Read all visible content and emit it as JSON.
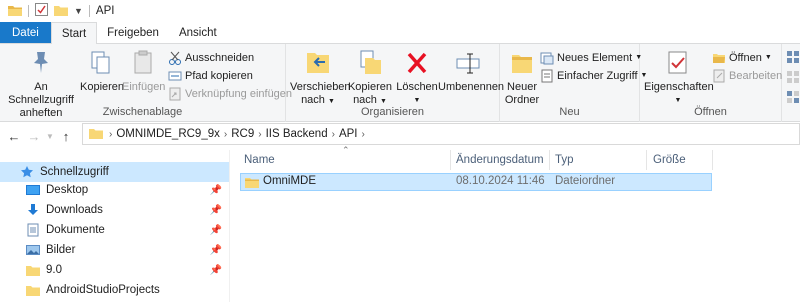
{
  "window": {
    "title": "API"
  },
  "tabs": [
    {
      "label": "Datei"
    },
    {
      "label": "Start"
    },
    {
      "label": "Freigeben"
    },
    {
      "label": "Ansicht"
    }
  ],
  "ribbon": {
    "clipboard": {
      "label": "Zwischenablage",
      "pin": {
        "line1": "An Schnellzugriff",
        "line2": "anheften"
      },
      "copy": "Kopieren",
      "paste": "Einfügen",
      "cut": "Ausschneiden",
      "copy_path": "Pfad kopieren",
      "paste_shortcut": "Verknüpfung einfügen"
    },
    "organize": {
      "label": "Organisieren",
      "move": {
        "line1": "Verschieben",
        "line2": "nach"
      },
      "copyto": {
        "line1": "Kopieren",
        "line2": "nach"
      },
      "delete": "Löschen",
      "rename": "Umbenennen"
    },
    "new": {
      "label": "Neu",
      "new_folder": {
        "line1": "Neuer",
        "line2": "Ordner"
      },
      "new_item": "Neues Element",
      "easy_access": "Einfacher Zugriff"
    },
    "open": {
      "label": "Öffnen",
      "properties": "Eigenschaften",
      "open": "Öffnen",
      "edit": "Bearbeiten"
    }
  },
  "address": {
    "crumbs": [
      "OMNIMDE_RC9_9x",
      "RC9",
      "IIS Backend",
      "API"
    ]
  },
  "nav": {
    "quick_access": "Schnellzugriff",
    "items": [
      {
        "label": "Desktop",
        "icon": "desktop-icon"
      },
      {
        "label": "Downloads",
        "icon": "download-icon"
      },
      {
        "label": "Dokumente",
        "icon": "documents-icon"
      },
      {
        "label": "Bilder",
        "icon": "pictures-icon"
      },
      {
        "label": "9.0",
        "icon": "folder-icon"
      },
      {
        "label": "AndroidStudioProjects",
        "icon": "folder-icon"
      }
    ]
  },
  "columns": {
    "name": "Name",
    "date": "Änderungsdatum",
    "type": "Typ",
    "size": "Größe"
  },
  "files": [
    {
      "name": "OmniMDE",
      "date": "08.10.2024 11:46",
      "type": "Dateiordner",
      "size": ""
    }
  ],
  "colors": {
    "accent": "#1979ca",
    "selection": "#cce8ff",
    "folder": "#f8d775"
  }
}
